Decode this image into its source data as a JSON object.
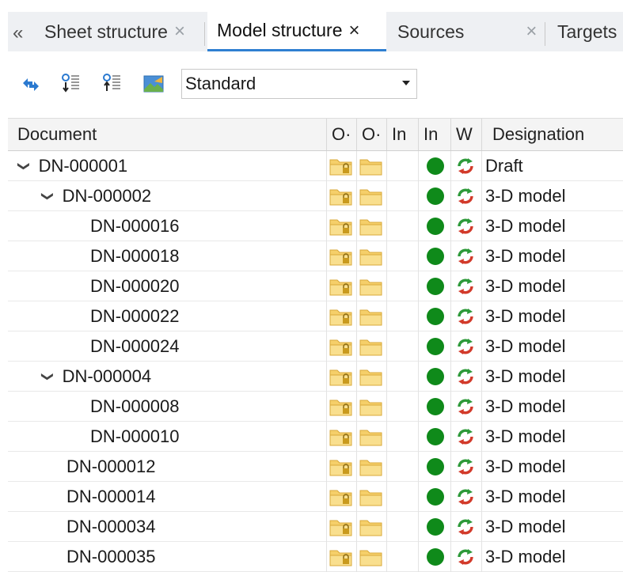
{
  "tabs": {
    "overflow_glyph": "«",
    "items": [
      {
        "label": "Sheet structure",
        "close": "×",
        "active": false
      },
      {
        "label": "Model structure",
        "close": "×",
        "active": true
      },
      {
        "label": "Sources",
        "close": "×",
        "active": false
      },
      {
        "label": "Targets",
        "close": "",
        "active": false
      }
    ]
  },
  "toolbar": {
    "icons": [
      "sync-arrows-icon",
      "move-down-icon",
      "move-up-icon",
      "image-view-icon"
    ],
    "view_select": {
      "value": "Standard"
    }
  },
  "columns": [
    "Document",
    "O·",
    "O·",
    "In",
    "In",
    "W",
    "Designation"
  ],
  "rows": [
    {
      "document": "DN-000001",
      "expanded": true,
      "designation": "Draft"
    },
    {
      "document": "DN-000002",
      "expanded": true,
      "designation": "3-D model"
    },
    {
      "document": "DN-000016",
      "expanded": null,
      "designation": "3-D model"
    },
    {
      "document": "DN-000018",
      "expanded": null,
      "designation": "3-D model"
    },
    {
      "document": "DN-000020",
      "expanded": null,
      "designation": "3-D model"
    },
    {
      "document": "DN-000022",
      "expanded": null,
      "designation": "3-D model"
    },
    {
      "document": "DN-000024",
      "expanded": null,
      "designation": "3-D model"
    },
    {
      "document": "DN-000004",
      "expanded": true,
      "designation": "3-D model"
    },
    {
      "document": "DN-000008",
      "expanded": null,
      "designation": "3-D model"
    },
    {
      "document": "DN-000010",
      "expanded": null,
      "designation": "3-D model"
    },
    {
      "document": "DN-000012",
      "expanded": null,
      "designation": "3-D model"
    },
    {
      "document": "DN-000014",
      "expanded": null,
      "designation": "3-D model"
    },
    {
      "document": "DN-000034",
      "expanded": null,
      "designation": "3-D model"
    },
    {
      "document": "DN-000035",
      "expanded": null,
      "designation": "3-D model"
    }
  ],
  "colors": {
    "accent": "#2f7fd1",
    "status_green": "#0f8a1a",
    "folder": "#f5cf6a"
  }
}
